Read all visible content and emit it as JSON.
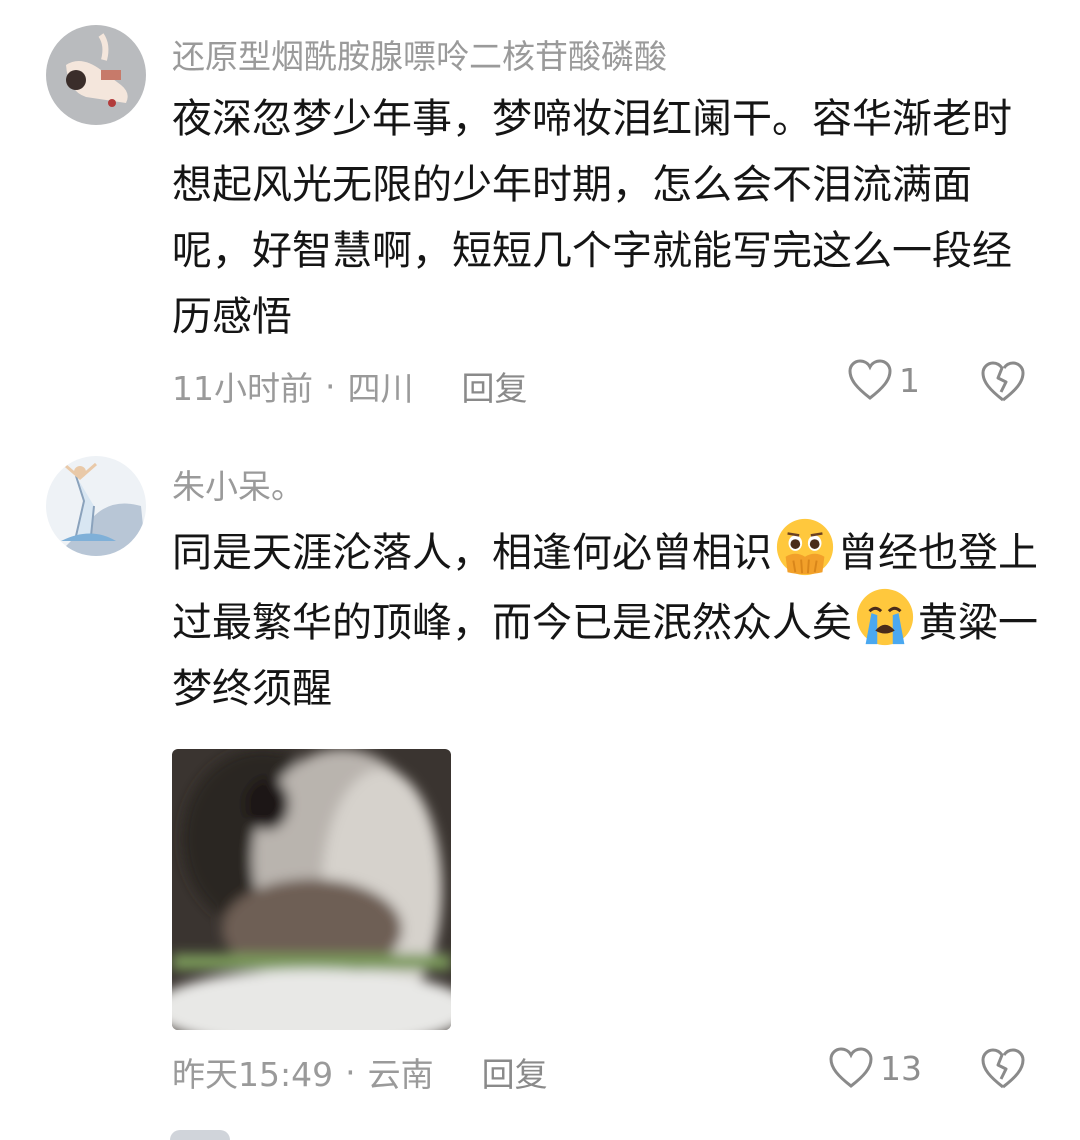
{
  "comments": [
    {
      "username": "还原型烟酰胺腺嘌呤二核苷酸磷酸",
      "text": "夜深忽梦少年事，梦啼妆泪红阑干。容华渐老时想起风光无限的少年时期，怎么会不泪流满面呢，好智慧啊，短短几个字就能写完这么一段经历感悟",
      "time": "11小时前",
      "location": "四川",
      "reply_label": "回复",
      "likes": "1",
      "avatar_icon": "girl-lying-avatar"
    },
    {
      "username": "朱小呆。",
      "text_parts": [
        "同是天涯沦落人，相逢何必曾相识",
        "曾经也登上过最繁华的顶峰，而今已是泯然众人矣",
        "黄粱一梦终须醒"
      ],
      "emojis": [
        "holding-back-tears-emoji",
        "loudly-crying-emoji"
      ],
      "time": "昨天15:49",
      "location": "云南",
      "reply_label": "回复",
      "likes": "13",
      "avatar_icon": "dancer-avatar",
      "photo_icon": "blurry-hamster-photo"
    }
  ],
  "separator": "·",
  "colors": {
    "meta_gray": "#9a9a9a",
    "text": "#151515"
  }
}
